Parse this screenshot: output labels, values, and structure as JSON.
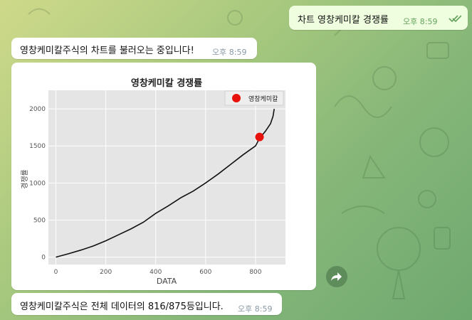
{
  "messages": {
    "outgoing": {
      "text": "차트 영창케미칼 경쟁률",
      "time": "오후 8:59",
      "status": "read-double-check-icon"
    },
    "loading": {
      "text": "영창케미칼주식의 차트를 불러오는 중입니다!",
      "time": "오후 8:59"
    },
    "result": {
      "text": "영창케미칼주식은 전체 데이터의 816/875등입니다.",
      "time": "오후 8:59"
    }
  },
  "icons": {
    "forward": "forward-arrow-icon",
    "read": "double-check-icon"
  },
  "colors": {
    "outgoing_bubble": "#eefedf",
    "marker": "#e8120c",
    "plot_bg": "#e5e5e5"
  },
  "chart_data": {
    "type": "line",
    "title": "영창케미칼  경쟁률",
    "xlabel": "DATA",
    "ylabel": "경쟁률",
    "xlim": [
      -30,
      920
    ],
    "ylim": [
      -100,
      2250
    ],
    "xticks": [
      "0",
      "200",
      "400",
      "600",
      "800"
    ],
    "yticks": [
      "0",
      "500",
      "1000",
      "1500",
      "2000"
    ],
    "grid": true,
    "legend": {
      "label": "영창케미칼",
      "position": "top-right"
    },
    "series": [
      {
        "x": [
          0,
          50,
          100,
          150,
          200,
          250,
          300,
          350,
          400,
          450,
          500,
          550,
          600,
          650,
          700,
          750,
          800,
          816,
          840,
          860,
          870,
          875
        ],
        "values": [
          0,
          45,
          95,
          150,
          220,
          300,
          380,
          470,
          590,
          690,
          800,
          890,
          1000,
          1120,
          1250,
          1380,
          1500,
          1600,
          1700,
          1800,
          1900,
          2000
        ]
      }
    ],
    "highlight": {
      "x": 816,
      "y": 1620,
      "label": "영창케미칼"
    }
  }
}
